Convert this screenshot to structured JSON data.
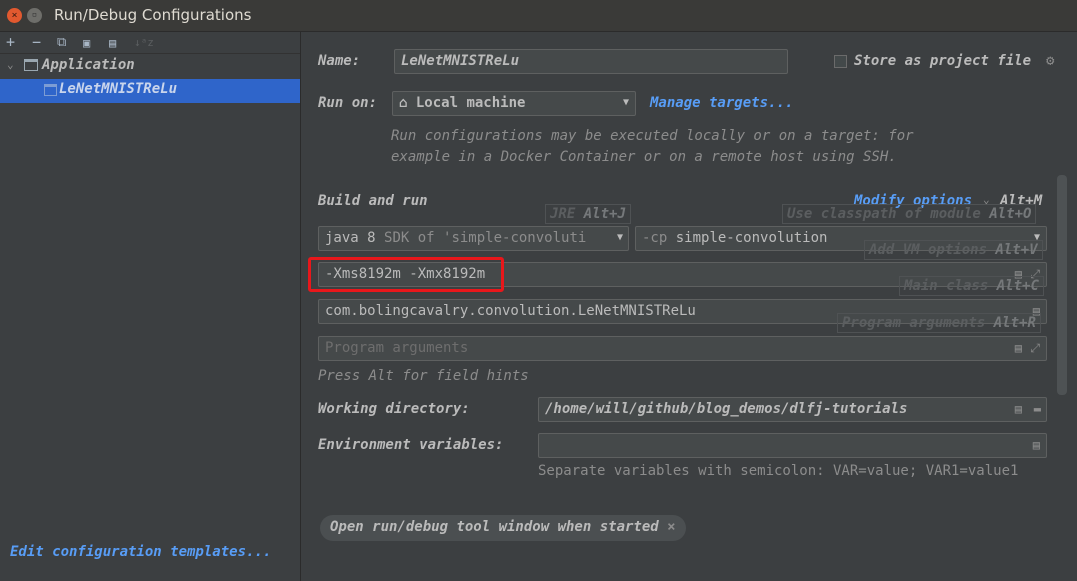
{
  "window": {
    "title": "Run/Debug Configurations"
  },
  "toolbar": {
    "add": "+",
    "remove": "−",
    "copy": "⧉",
    "save": "💾",
    "folder": "▤",
    "sort": "↓ᵃz"
  },
  "tree": {
    "group": "Application",
    "item": "LeNetMNISTReLu"
  },
  "left_footer": {
    "templates_link": "Edit configuration templates..."
  },
  "form": {
    "name_label": "Name:",
    "name_value": "LeNetMNISTReLu",
    "store_label": "Store as project file",
    "run_on_label": "Run on:",
    "run_on_value": "Local machine",
    "manage_targets": "Manage targets...",
    "run_on_desc_1": "Run configurations may be executed locally or on a target: for",
    "run_on_desc_2": "example in a Docker Container or on a remote host using SSH.",
    "build_run": "Build and run",
    "modify_options": "Modify options",
    "modify_shortcut": "Alt+M",
    "jre_hint": "JRE",
    "jre_key": "Alt+J",
    "classpath_hint": "Use classpath of module",
    "classpath_key": "Alt+O",
    "vm_hint": "Add VM options",
    "vm_key": "Alt+V",
    "main_hint": "Main class",
    "main_key": "Alt+C",
    "args_hint": "Program arguments",
    "args_key": "Alt+R",
    "jdk_value": "java 8",
    "jdk_suffix": "SDK of 'simple-convoluti",
    "cp_prefix": "-cp",
    "cp_value": "simple-convolution",
    "vm_options": "-Xms8192m -Xmx8192m",
    "main_class": "com.bolingcavalry.convolution.LeNetMNISTReLu",
    "program_args_placeholder": "Program arguments",
    "field_hints": "Press Alt for field hints",
    "workdir_label": "Working directory:",
    "workdir_value": "/home/will/github/blog_demos/dlfj-tutorials",
    "env_label": "Environment variables:",
    "env_value": "",
    "env_hint": "Separate variables with semicolon: VAR=value; VAR1=value1",
    "tag_open_tool": "Open run/debug tool window when started"
  },
  "highlight_color": "#e8171b"
}
